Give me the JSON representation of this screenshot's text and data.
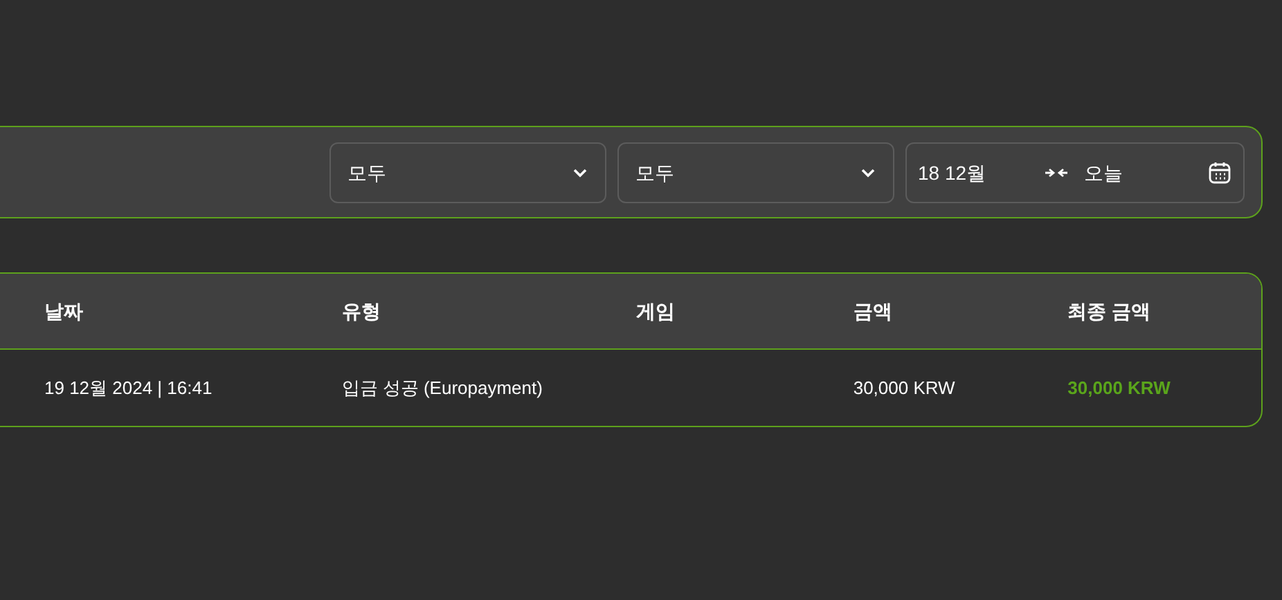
{
  "filters": {
    "selects": [
      {
        "value": "모두"
      },
      {
        "value": "모두"
      }
    ],
    "date_range": {
      "from": "18 12월",
      "to": "오늘"
    }
  },
  "table": {
    "columns": [
      {
        "label": "날짜",
        "kind": "plain"
      },
      {
        "label": "유형",
        "kind": "plain"
      },
      {
        "label": "게임",
        "kind": "plain"
      },
      {
        "label": "금액",
        "kind": "plain"
      },
      {
        "label": "최종 금액",
        "kind": "highlight"
      }
    ],
    "rows": [
      {
        "cells": [
          "19 12월 2024 | 16:41",
          "입금 성공 (Europayment)",
          "",
          "30,000 KRW",
          "30,000 KRW"
        ]
      }
    ]
  }
}
